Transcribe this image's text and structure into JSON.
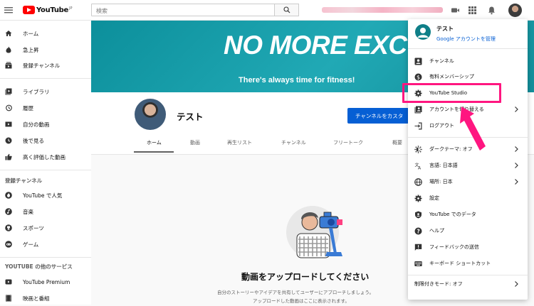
{
  "header": {
    "logo_text": "YouTube",
    "logo_region": "JP",
    "search_placeholder": "検索"
  },
  "sidebar": {
    "main": [
      "ホーム",
      "急上昇",
      "登録チャンネル"
    ],
    "library": [
      "ライブラリ",
      "履歴",
      "自分の動画",
      "後で見る",
      "高く評価した動画"
    ],
    "subscriptions_heading": "登録チャンネル",
    "subscriptions": [
      "YouTube で人気",
      "音楽",
      "スポーツ",
      "ゲーム"
    ],
    "more_heading": "YOUTUBE の他のサービス",
    "more": [
      "YouTube Premium",
      "映画と番組"
    ]
  },
  "banner": {
    "headline": "NO MORE EXCUSES",
    "subline": "There's always time for fitness!"
  },
  "channel": {
    "name": "テスト",
    "customize_button": "チャンネルをカスタ",
    "tabs": [
      "ホーム",
      "動画",
      "再生リスト",
      "チャンネル",
      "フリートーク",
      "概要"
    ],
    "active_tab": "ホーム"
  },
  "empty_state": {
    "heading": "動画をアップロードしてください",
    "line1": "自分のストーリーやアイデアを共有してユーザーにアプローチしましょう。",
    "line2": "アップロードした動画はここに表示されます。"
  },
  "account_menu": {
    "user_name": "テスト",
    "manage_link": "Google アカウントを管理",
    "items": [
      {
        "label": "チャンネル",
        "icon": "channel-icon"
      },
      {
        "label": "有料メンバーシップ",
        "icon": "dollar-icon"
      },
      {
        "label": "YouTube Studio",
        "icon": "gear-icon"
      },
      {
        "label": "アカウントを切り替える",
        "icon": "switch-account-icon"
      },
      {
        "label": "ログアウト",
        "icon": "logout-icon"
      },
      {
        "label": "ダークテーマ: オフ",
        "icon": "dark-theme-icon"
      },
      {
        "label": "言語: 日本語",
        "icon": "translate-icon"
      },
      {
        "label": "場所: 日本",
        "icon": "globe-icon"
      },
      {
        "label": "設定",
        "icon": "gear-icon"
      },
      {
        "label": "YouTube でのデータ",
        "icon": "shield-icon"
      },
      {
        "label": "ヘルプ",
        "icon": "help-icon"
      },
      {
        "label": "フィードバックの送信",
        "icon": "feedback-icon"
      },
      {
        "label": "キーボード ショートカット",
        "icon": "keyboard-icon"
      },
      {
        "label": "制限付きモード: オフ",
        "icon": ""
      }
    ]
  },
  "colors": {
    "brand_red": "#ff0000",
    "banner_teal": "#21a9b5",
    "highlight_pink": "#ff1680",
    "link_blue": "#065fd4"
  }
}
